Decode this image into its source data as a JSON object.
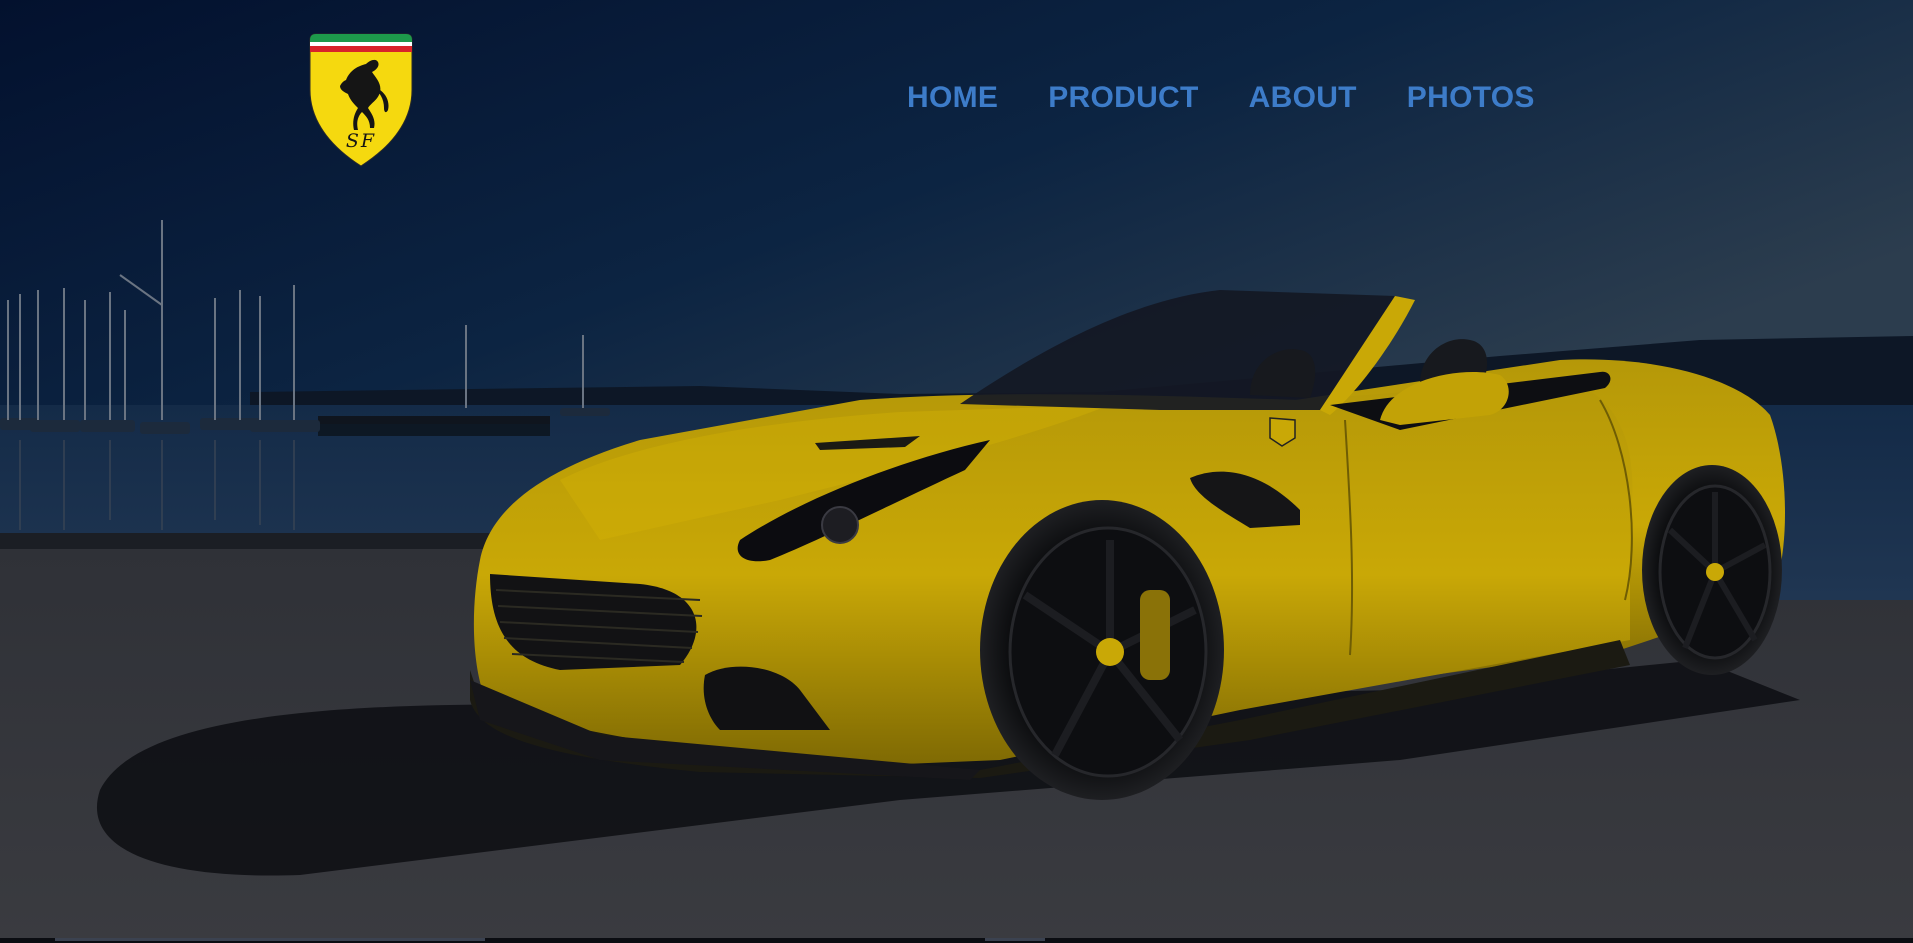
{
  "brand": {
    "logo_alt": "Ferrari logo",
    "logo_initials": "SF",
    "shield_color": "#f5d90f",
    "stripe_colors": [
      "#1d9a4b",
      "#ffffff",
      "#d8232a"
    ]
  },
  "nav": {
    "items": [
      {
        "label": "HOME"
      },
      {
        "label": "PRODUCT"
      },
      {
        "label": "ABOUT"
      },
      {
        "label": "PHOTOS"
      }
    ],
    "link_color": "#3d7cc9"
  },
  "hero": {
    "image_alt": "Yellow convertible sports car parked by a marina at dusk",
    "car_color": "#c9a806",
    "overlay_color": "#0a1a33"
  }
}
